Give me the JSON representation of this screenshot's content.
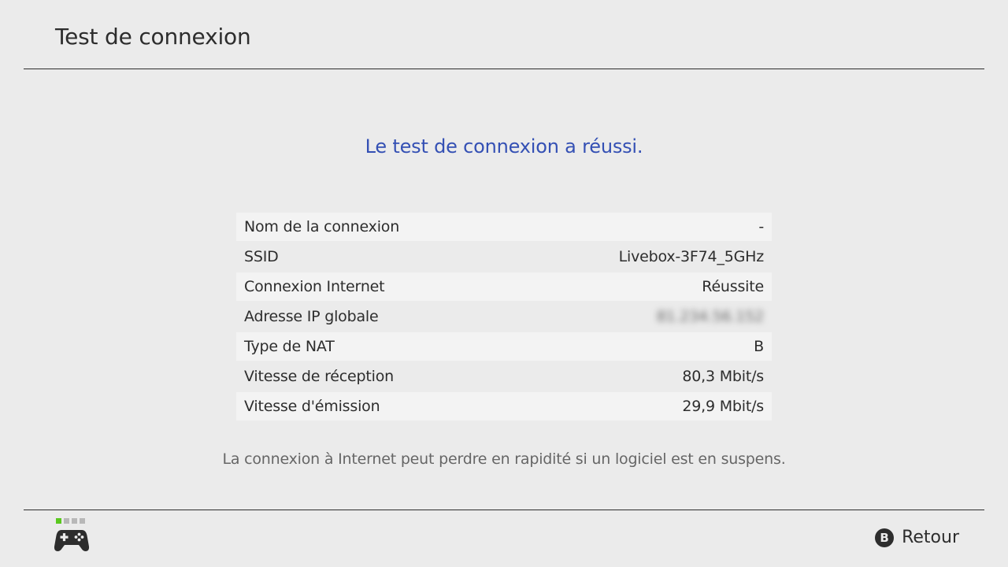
{
  "header": {
    "title": "Test de connexion"
  },
  "result": {
    "message": "Le test de connexion a réussi."
  },
  "info_rows": [
    {
      "label": "Nom de la connexion",
      "value": "-"
    },
    {
      "label": "SSID",
      "value": "Livebox-3F74_5GHz"
    },
    {
      "label": "Connexion Internet",
      "value": "Réussite"
    },
    {
      "label": "Adresse IP globale",
      "value": "81.234.56.152"
    },
    {
      "label": "Type de NAT",
      "value": "B"
    },
    {
      "label": "Vitesse de réception",
      "value": "80,3 Mbit/s"
    },
    {
      "label": "Vitesse d'émission",
      "value": "29,9 Mbit/s"
    }
  ],
  "note": "La connexion à Internet peut perdre en rapidité si un logiciel est en suspens.",
  "footer": {
    "back_button_glyph": "B",
    "back_label": "Retour",
    "controller_icon": "gamepad-icon",
    "active_player": 1,
    "player_slots": 4
  },
  "colors": {
    "background": "#ebebeb",
    "accent_text": "#3450b4",
    "row_alt": "#f3f3f3",
    "player_active": "#5ac81e"
  }
}
